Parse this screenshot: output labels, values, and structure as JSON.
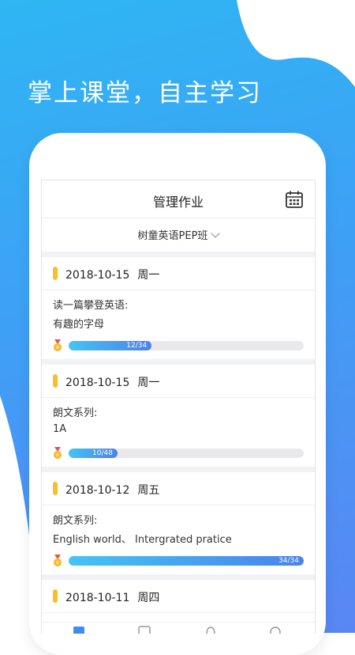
{
  "tagline": "掌上课堂，自主学习",
  "colors": {
    "accent_bar": "#f8bf2c",
    "progress_start": "#45c4f3",
    "progress_end": "#4a82ea",
    "background": "#3ea0f5"
  },
  "header": {
    "title": "管理作业",
    "calendar_icon": "calendar-icon"
  },
  "class_selector": {
    "label": "树童英语PEP班",
    "icon": "chevron-down-icon"
  },
  "assignments": [
    {
      "date": "2018-10-15",
      "weekday": "周一",
      "series": "读一篇攀登英语:",
      "subtitle": "有趣的字母",
      "progress_text": "12/34",
      "progress": 0.353
    },
    {
      "date": "2018-10-15",
      "weekday": "周一",
      "series": "朗文系列:",
      "subtitle": "1A",
      "progress_text": "10/48",
      "progress": 0.208
    },
    {
      "date": "2018-10-12",
      "weekday": "周五",
      "series": "朗文系列:",
      "subtitle": "English world、 Intergrated pratice",
      "progress_text": "34/34",
      "progress": 1.0
    },
    {
      "date": "2018-10-11",
      "weekday": "周四"
    }
  ],
  "tabbar": {
    "icons": [
      "homework-icon",
      "calendar-check-icon",
      "bell-icon",
      "profile-icon"
    ]
  }
}
